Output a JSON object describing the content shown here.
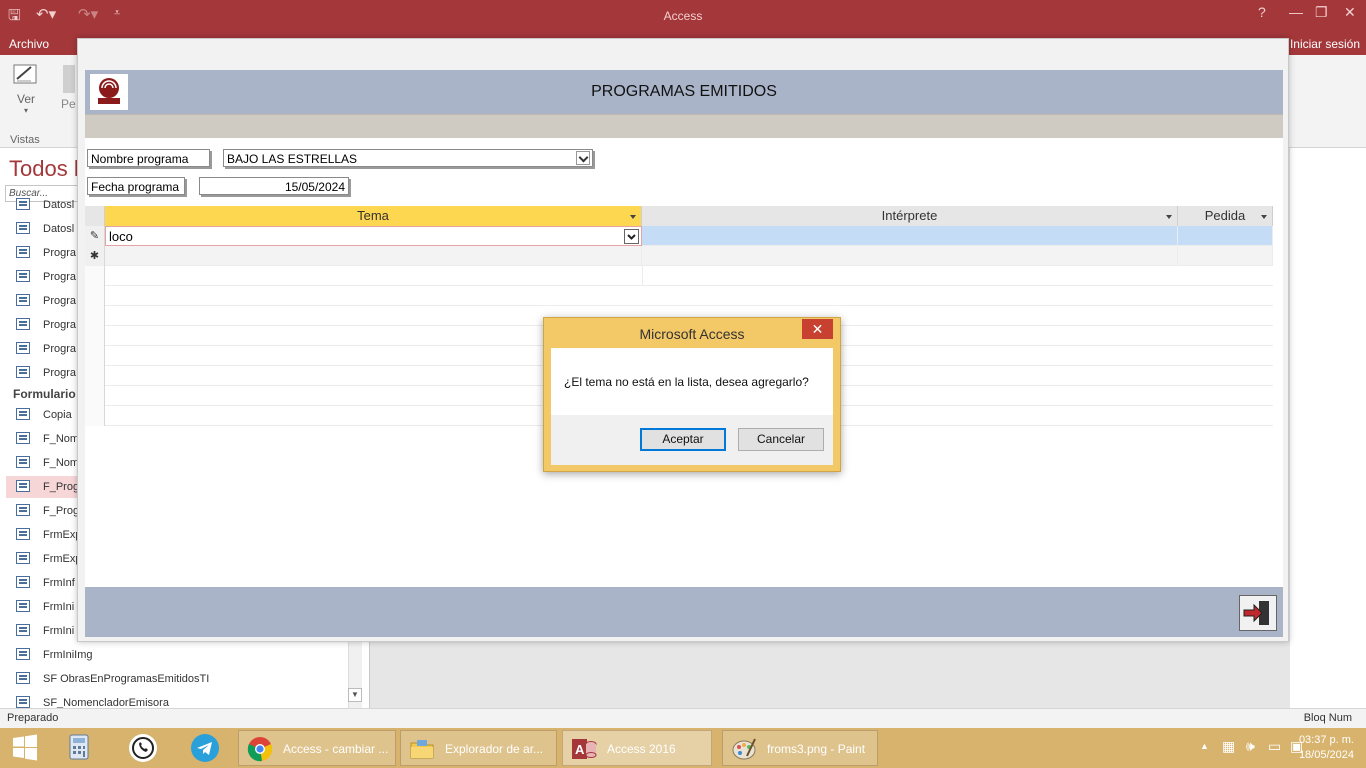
{
  "window": {
    "title": "Access",
    "ribbon_tab_file": "Archivo",
    "sign_in": "Iniciar sesión",
    "view_button": "Ver",
    "views_group": "Vistas",
    "pe_label": "Pe"
  },
  "nav": {
    "title": "Todos l",
    "search_placeholder": "Buscar...",
    "group_forms": "Formulario",
    "items_top": [
      "Datosl",
      "Datosl",
      "Progra",
      "Progra",
      "Progra",
      "Progra",
      "Progra",
      "Progra"
    ],
    "items_forms": [
      "Copia",
      "F_Nom",
      "F_Nom",
      "F_Prog",
      "F_Prog",
      "FrmExp",
      "FrmExp",
      "FrmInf",
      "FrmIni",
      "FrmIni",
      "FrmIniImg",
      "SF ObrasEnProgramasEmitidosTI",
      "SF_NomencladorEmisora"
    ]
  },
  "form": {
    "title": "PROGRAMAS EMITIDOS",
    "nombre_label": "Nombre programa",
    "nombre_value": "BAJO LAS ESTRELLAS",
    "fecha_label": "Fecha programa",
    "fecha_value": "15/05/2024",
    "grid": {
      "columns": [
        "Tema",
        "Intérprete",
        "Pedida"
      ],
      "current_value": "loco",
      "new_row_marker": "✱",
      "edit_marker": "✎"
    }
  },
  "dialog": {
    "title": "Microsoft Access",
    "message": "¿El tema no está en la lista, desea agregarlo?",
    "ok": "Aceptar",
    "cancel": "Cancelar",
    "close": "✕"
  },
  "status": {
    "left": "Preparado",
    "right": "Bloq Num"
  },
  "taskbar": {
    "apps": [
      {
        "label": "Access - cambiar ...",
        "color": "#ffffff"
      },
      {
        "label": "Explorador de ar...",
        "color": "#f2c94c"
      },
      {
        "label": "Access 2016",
        "color": "#a4373a"
      },
      {
        "label": "froms3.png - Paint",
        "color": "#6fa8dc"
      }
    ],
    "time": "03:37 p. m.",
    "date": "18/05/2024"
  },
  "colors": {
    "accent": "#a4373a",
    "header": "#aab4c8",
    "dialog_frame": "#f3c867",
    "taskbar": "#d7b36e"
  }
}
